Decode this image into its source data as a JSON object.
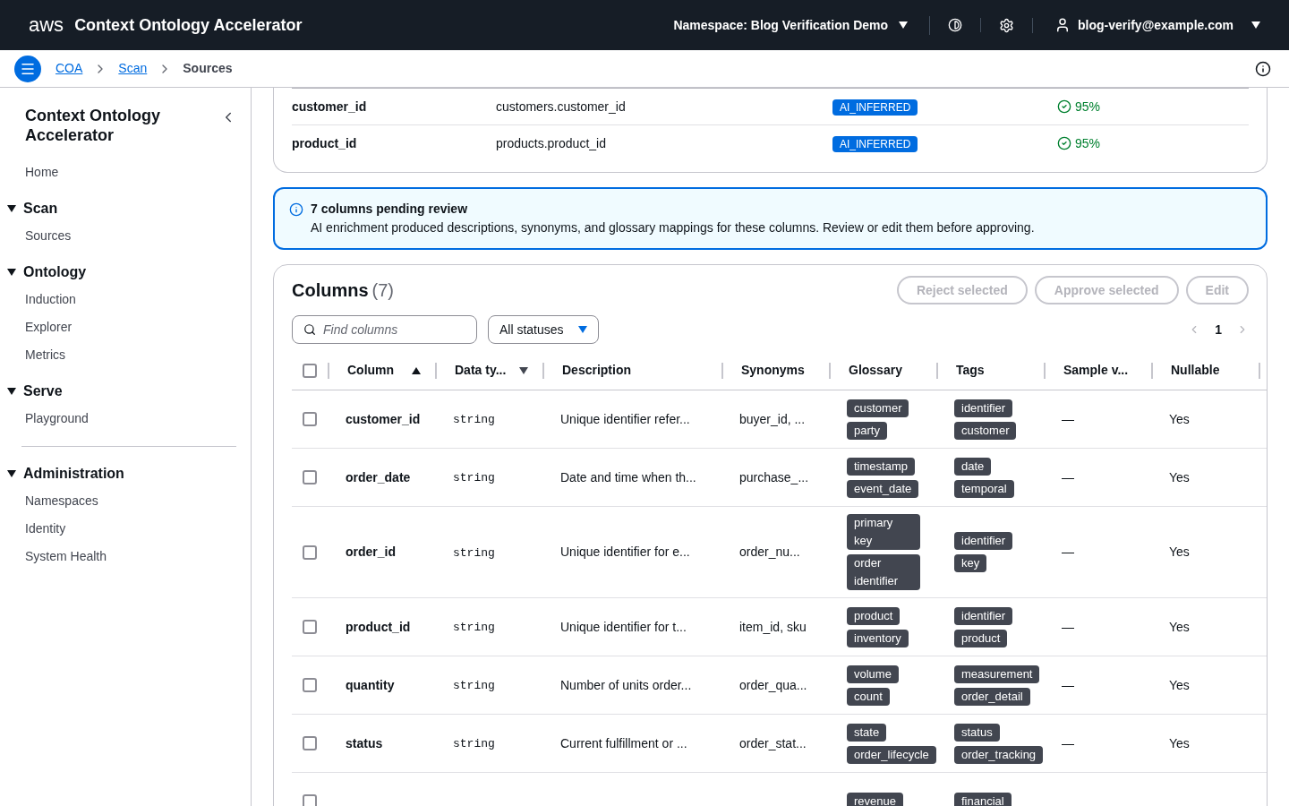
{
  "header": {
    "logo": "aws",
    "title": "Context Ontology Accelerator",
    "namespace": "Namespace: Blog Verification Demo",
    "user": "blog-verify@example.com"
  },
  "breadcrumbs": [
    {
      "label": "COA",
      "link": true
    },
    {
      "label": "Scan",
      "link": true
    },
    {
      "label": "Sources",
      "link": false
    }
  ],
  "sidebar": {
    "title": "Context Ontology Accelerator",
    "home": "Home",
    "groups": [
      {
        "label": "Scan",
        "expanded": true,
        "children": [
          {
            "label": "Sources"
          }
        ]
      },
      {
        "label": "Ontology",
        "expanded": true,
        "children": [
          {
            "label": "Induction"
          },
          {
            "label": "Explorer"
          },
          {
            "label": "Metrics"
          }
        ]
      },
      {
        "label": "Serve",
        "expanded": true,
        "children": [
          {
            "label": "Playground"
          }
        ]
      }
    ],
    "admin_groups": [
      {
        "label": "Administration",
        "expanded": true,
        "children": [
          {
            "label": "Namespaces"
          },
          {
            "label": "Identity"
          },
          {
            "label": "System Health"
          }
        ]
      }
    ]
  },
  "relationships": [
    {
      "column": "customer_id",
      "target": "customers.customer_id",
      "badge": "AI_INFERRED",
      "confidence": "95%"
    },
    {
      "column": "product_id",
      "target": "products.product_id",
      "badge": "AI_INFERRED",
      "confidence": "95%"
    }
  ],
  "alert": {
    "title": "7 columns pending review",
    "body": "AI enrichment produced descriptions, synonyms, and glossary mappings for these columns. Review or edit them before approving."
  },
  "columns_panel": {
    "title": "Columns",
    "count": "(7)",
    "buttons": [
      "Reject selected",
      "Approve selected",
      "Edit"
    ],
    "search": {
      "placeholder": "Find columns"
    },
    "filter": "All statuses",
    "page": "1",
    "all_checked": false,
    "headers": [
      {
        "label": "Column",
        "kind": "sorted"
      },
      {
        "label": "Data ty...",
        "kind": "sortable"
      },
      {
        "label": "Description",
        "kind": "plain"
      },
      {
        "label": "Synonyms",
        "kind": "plain"
      },
      {
        "label": "Glossary",
        "kind": "plain"
      },
      {
        "label": "Tags",
        "kind": "plain"
      },
      {
        "label": "Sample v...",
        "kind": "plain"
      },
      {
        "label": "Nullable",
        "kind": "plain"
      }
    ],
    "rows": [
      {
        "checked": false,
        "name": "customer_id",
        "type": "string",
        "description": "Unique identifier refer...",
        "synonyms": "buyer_id, ...",
        "glossary": [
          "customer",
          "party"
        ],
        "tags": [
          "identifier",
          "customer"
        ],
        "sample": "—",
        "nullable": "Yes"
      },
      {
        "checked": false,
        "name": "order_date",
        "type": "string",
        "description": "Date and time when th...",
        "synonyms": "purchase_...",
        "glossary": [
          "timestamp",
          "event_date"
        ],
        "tags": [
          "date",
          "temporal"
        ],
        "sample": "—",
        "nullable": "Yes"
      },
      {
        "checked": false,
        "name": "order_id",
        "type": "string",
        "description": "Unique identifier for e...",
        "synonyms": "order_nu...",
        "glossary": [
          "primary key",
          "order identifier"
        ],
        "tags": [
          "identifier",
          "key"
        ],
        "sample": "—",
        "nullable": "Yes"
      },
      {
        "checked": false,
        "name": "product_id",
        "type": "string",
        "description": "Unique identifier for t...",
        "synonyms": "item_id, sku",
        "glossary": [
          "product",
          "inventory"
        ],
        "tags": [
          "identifier",
          "product"
        ],
        "sample": "—",
        "nullable": "Yes"
      },
      {
        "checked": false,
        "name": "quantity",
        "type": "string",
        "description": "Number of units order...",
        "synonyms": "order_qua...",
        "glossary": [
          "volume",
          "count"
        ],
        "tags": [
          "measurement",
          "order_detail"
        ],
        "sample": "—",
        "nullable": "Yes"
      },
      {
        "checked": false,
        "name": "status",
        "type": "string",
        "description": "Current fulfillment or ...",
        "synonyms": "order_stat...",
        "glossary": [
          "state",
          "order_lifecycle"
        ],
        "tags": [
          "status",
          "order_tracking"
        ],
        "sample": "—",
        "nullable": "Yes"
      },
      {
        "checked": false,
        "glossary": [
          "revenue"
        ],
        "tags": [
          "financial"
        ]
      }
    ]
  }
}
